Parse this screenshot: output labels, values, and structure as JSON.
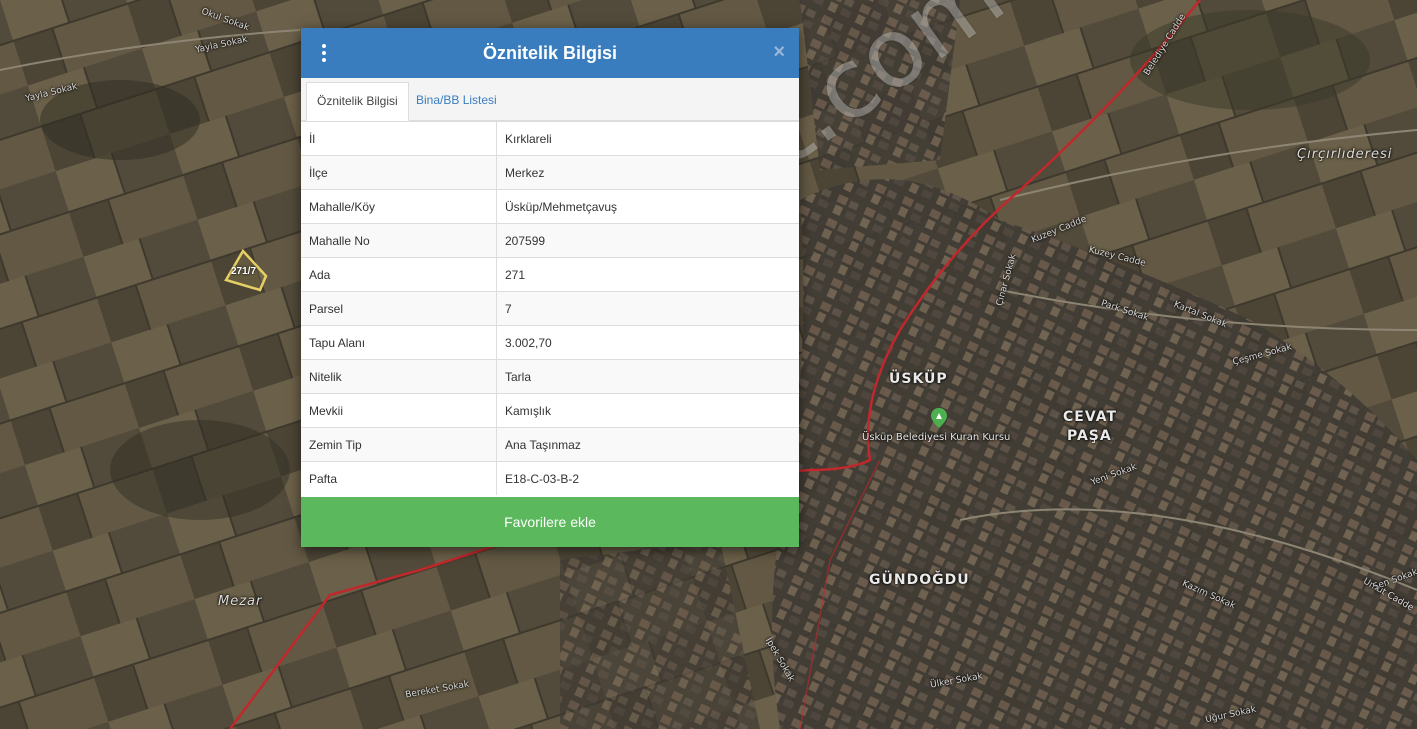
{
  "modal": {
    "title": "Öznitelik Bilgisi",
    "tabs": [
      {
        "label": "Öznitelik Bilgisi",
        "active": true
      },
      {
        "label": "Bina/BB Listesi",
        "active": false
      }
    ],
    "rows": [
      {
        "key": "İl",
        "value": "Kırklareli"
      },
      {
        "key": "İlçe",
        "value": "Merkez"
      },
      {
        "key": "Mahalle/Köy",
        "value": "Üsküp/Mehmetçavuş"
      },
      {
        "key": "Mahalle No",
        "value": "207599"
      },
      {
        "key": "Ada",
        "value": "271"
      },
      {
        "key": "Parsel",
        "value": "7"
      },
      {
        "key": "Tapu Alanı",
        "value": "3.002,70"
      },
      {
        "key": "Nitelik",
        "value": "Tarla"
      },
      {
        "key": "Mevkii",
        "value": "Kamışlık"
      },
      {
        "key": "Zemin Tip",
        "value": "Ana Taşınmaz"
      },
      {
        "key": "Pafta",
        "value": "E18-C-03-B-2"
      }
    ],
    "favorite_button": "Favorilere ekle",
    "close_icon": "close-icon",
    "menu_icon": "kebab-menu-icon",
    "colors": {
      "header": "#3a7dbf",
      "button": "#5cb85c"
    }
  },
  "map": {
    "parcel_label": "271/7",
    "watermark": "emlakjet.com",
    "labels": {
      "ciftlik": "Çırçırlıderesi",
      "uskup": "ÜSKÜP",
      "cevat": "CEVAT",
      "pasa": "PAŞA",
      "gundogdu": "GÜNDOĞDU",
      "mezar": "Mezar",
      "kuran": "Üsküp Belediyesi Kuran Kursu",
      "belediye_cadde": "Belediye Cadde",
      "kuzey_cadde": "Kuzey Cadde",
      "kuzey_cadde2": "Kuzey Cadde",
      "yayla1": "Yayla Sokak",
      "yayla2": "Yayla Sokak",
      "okul": "Okul Sokak",
      "park": "Park Sokak",
      "kartal": "Kartal Sokak",
      "cesme": "Çeşme Sokak",
      "ugur": "Uğur Sokak",
      "sen": "Şen Sokak",
      "bereket": "Bereket Sokak",
      "ipek": "İpek Sokak",
      "ulker": "Ülker Sokak",
      "cinar": "Çınar Sokak",
      "yeni": "Yeni Sokak",
      "kazım": "Kazım Sokak",
      "umut": "Umut Cadde"
    }
  }
}
